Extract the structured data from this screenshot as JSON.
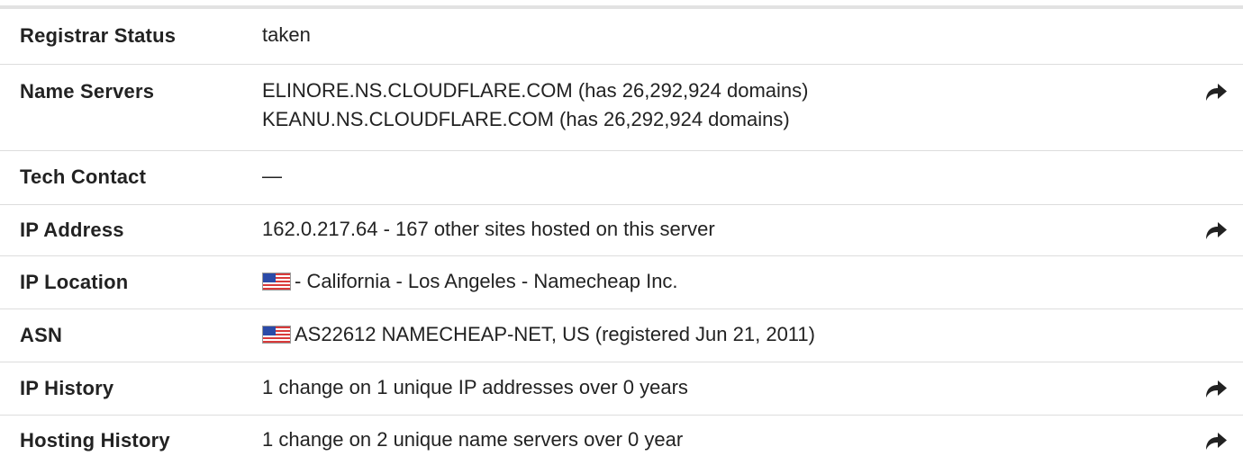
{
  "rows": [
    {
      "label": "Registrar Status",
      "lines": [
        "taken"
      ],
      "share": false
    },
    {
      "label": "Name Servers",
      "lines": [
        "ELINORE.NS.CLOUDFLARE.COM (has 26,292,924 domains)",
        "KEANU.NS.CLOUDFLARE.COM (has 26,292,924 domains)"
      ],
      "share": true
    },
    {
      "label": "Tech Contact",
      "lines": [
        "—"
      ],
      "share": false
    },
    {
      "label": "IP Address",
      "lines": [
        "162.0.217.64 - 167 other sites hosted on this server"
      ],
      "share": true
    },
    {
      "label": "IP Location",
      "flag": "us-flag-icon",
      "lines": [
        "- California - Los Angeles - Namecheap Inc."
      ],
      "share": false
    },
    {
      "label": "ASN",
      "flag": "us-flag-icon",
      "lines": [
        "AS22612 NAMECHEAP-NET, US (registered Jun 21, 2011)"
      ],
      "share": false
    },
    {
      "label": "IP History",
      "lines": [
        "1 change on 1 unique IP addresses over 0 years"
      ],
      "share": true
    },
    {
      "label": "Hosting History",
      "lines": [
        "1 change on 2 unique name servers over 0 year"
      ],
      "share": true
    }
  ],
  "colors": {
    "text": "#222222",
    "divider": "#dddddd",
    "top_rule": "#e2e2e2",
    "flag_red": "#d93a3a",
    "flag_blue": "#2b4aa8"
  },
  "icons": {
    "share": "share-arrow-icon",
    "flag": "us-flag-icon"
  }
}
